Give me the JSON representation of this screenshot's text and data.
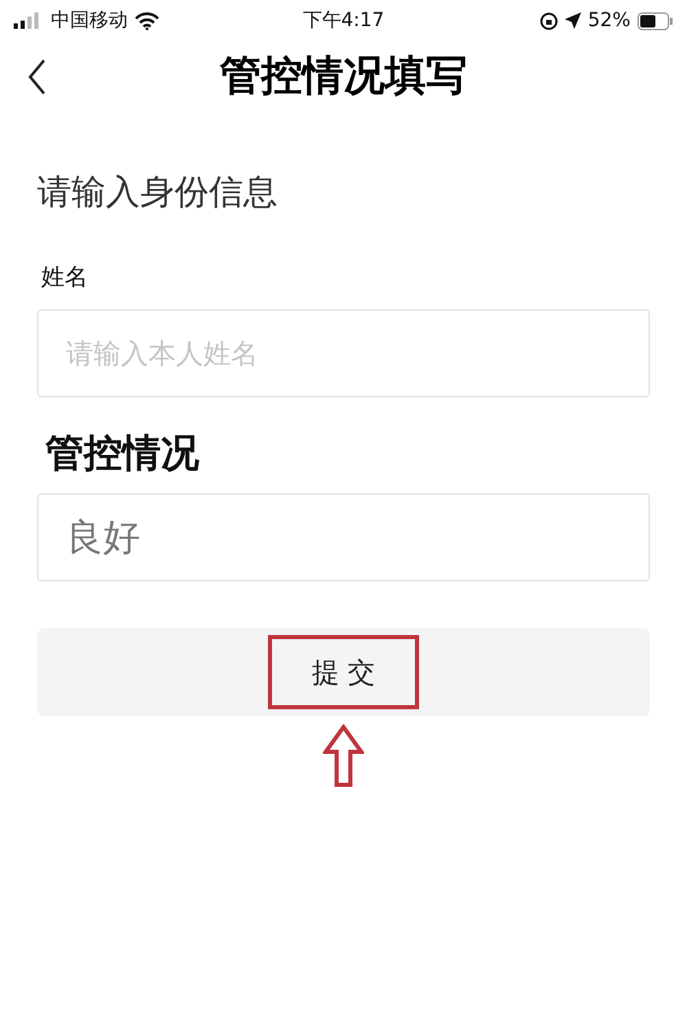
{
  "status_bar": {
    "carrier": "中国移动",
    "time": "下午4:17",
    "battery": "52%"
  },
  "nav": {
    "title": "管控情况填写"
  },
  "heading": "请输入身份信息",
  "fields": [
    {
      "label": "姓名",
      "placeholder": "请输入本人姓名",
      "kind": "plain"
    },
    {
      "label": "管控情况",
      "value": "良好",
      "kind": "emphasis"
    }
  ],
  "submit": {
    "label": "提 交",
    "highlighted": true
  }
}
